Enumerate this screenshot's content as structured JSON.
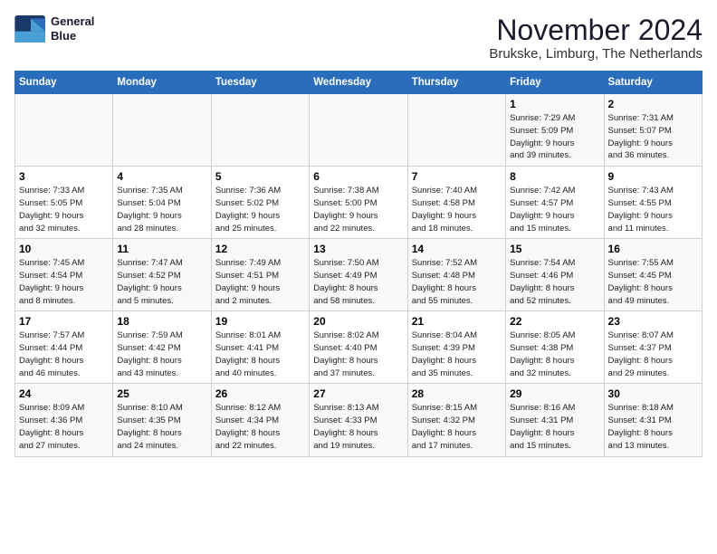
{
  "header": {
    "logo_line1": "General",
    "logo_line2": "Blue",
    "title": "November 2024",
    "subtitle": "Brukske, Limburg, The Netherlands"
  },
  "weekdays": [
    "Sunday",
    "Monday",
    "Tuesday",
    "Wednesday",
    "Thursday",
    "Friday",
    "Saturday"
  ],
  "weeks": [
    [
      {
        "day": "",
        "info": ""
      },
      {
        "day": "",
        "info": ""
      },
      {
        "day": "",
        "info": ""
      },
      {
        "day": "",
        "info": ""
      },
      {
        "day": "",
        "info": ""
      },
      {
        "day": "1",
        "info": "Sunrise: 7:29 AM\nSunset: 5:09 PM\nDaylight: 9 hours\nand 39 minutes."
      },
      {
        "day": "2",
        "info": "Sunrise: 7:31 AM\nSunset: 5:07 PM\nDaylight: 9 hours\nand 36 minutes."
      }
    ],
    [
      {
        "day": "3",
        "info": "Sunrise: 7:33 AM\nSunset: 5:05 PM\nDaylight: 9 hours\nand 32 minutes."
      },
      {
        "day": "4",
        "info": "Sunrise: 7:35 AM\nSunset: 5:04 PM\nDaylight: 9 hours\nand 28 minutes."
      },
      {
        "day": "5",
        "info": "Sunrise: 7:36 AM\nSunset: 5:02 PM\nDaylight: 9 hours\nand 25 minutes."
      },
      {
        "day": "6",
        "info": "Sunrise: 7:38 AM\nSunset: 5:00 PM\nDaylight: 9 hours\nand 22 minutes."
      },
      {
        "day": "7",
        "info": "Sunrise: 7:40 AM\nSunset: 4:58 PM\nDaylight: 9 hours\nand 18 minutes."
      },
      {
        "day": "8",
        "info": "Sunrise: 7:42 AM\nSunset: 4:57 PM\nDaylight: 9 hours\nand 15 minutes."
      },
      {
        "day": "9",
        "info": "Sunrise: 7:43 AM\nSunset: 4:55 PM\nDaylight: 9 hours\nand 11 minutes."
      }
    ],
    [
      {
        "day": "10",
        "info": "Sunrise: 7:45 AM\nSunset: 4:54 PM\nDaylight: 9 hours\nand 8 minutes."
      },
      {
        "day": "11",
        "info": "Sunrise: 7:47 AM\nSunset: 4:52 PM\nDaylight: 9 hours\nand 5 minutes."
      },
      {
        "day": "12",
        "info": "Sunrise: 7:49 AM\nSunset: 4:51 PM\nDaylight: 9 hours\nand 2 minutes."
      },
      {
        "day": "13",
        "info": "Sunrise: 7:50 AM\nSunset: 4:49 PM\nDaylight: 8 hours\nand 58 minutes."
      },
      {
        "day": "14",
        "info": "Sunrise: 7:52 AM\nSunset: 4:48 PM\nDaylight: 8 hours\nand 55 minutes."
      },
      {
        "day": "15",
        "info": "Sunrise: 7:54 AM\nSunset: 4:46 PM\nDaylight: 8 hours\nand 52 minutes."
      },
      {
        "day": "16",
        "info": "Sunrise: 7:55 AM\nSunset: 4:45 PM\nDaylight: 8 hours\nand 49 minutes."
      }
    ],
    [
      {
        "day": "17",
        "info": "Sunrise: 7:57 AM\nSunset: 4:44 PM\nDaylight: 8 hours\nand 46 minutes."
      },
      {
        "day": "18",
        "info": "Sunrise: 7:59 AM\nSunset: 4:42 PM\nDaylight: 8 hours\nand 43 minutes."
      },
      {
        "day": "19",
        "info": "Sunrise: 8:01 AM\nSunset: 4:41 PM\nDaylight: 8 hours\nand 40 minutes."
      },
      {
        "day": "20",
        "info": "Sunrise: 8:02 AM\nSunset: 4:40 PM\nDaylight: 8 hours\nand 37 minutes."
      },
      {
        "day": "21",
        "info": "Sunrise: 8:04 AM\nSunset: 4:39 PM\nDaylight: 8 hours\nand 35 minutes."
      },
      {
        "day": "22",
        "info": "Sunrise: 8:05 AM\nSunset: 4:38 PM\nDaylight: 8 hours\nand 32 minutes."
      },
      {
        "day": "23",
        "info": "Sunrise: 8:07 AM\nSunset: 4:37 PM\nDaylight: 8 hours\nand 29 minutes."
      }
    ],
    [
      {
        "day": "24",
        "info": "Sunrise: 8:09 AM\nSunset: 4:36 PM\nDaylight: 8 hours\nand 27 minutes."
      },
      {
        "day": "25",
        "info": "Sunrise: 8:10 AM\nSunset: 4:35 PM\nDaylight: 8 hours\nand 24 minutes."
      },
      {
        "day": "26",
        "info": "Sunrise: 8:12 AM\nSunset: 4:34 PM\nDaylight: 8 hours\nand 22 minutes."
      },
      {
        "day": "27",
        "info": "Sunrise: 8:13 AM\nSunset: 4:33 PM\nDaylight: 8 hours\nand 19 minutes."
      },
      {
        "day": "28",
        "info": "Sunrise: 8:15 AM\nSunset: 4:32 PM\nDaylight: 8 hours\nand 17 minutes."
      },
      {
        "day": "29",
        "info": "Sunrise: 8:16 AM\nSunset: 4:31 PM\nDaylight: 8 hours\nand 15 minutes."
      },
      {
        "day": "30",
        "info": "Sunrise: 8:18 AM\nSunset: 4:31 PM\nDaylight: 8 hours\nand 13 minutes."
      }
    ]
  ]
}
